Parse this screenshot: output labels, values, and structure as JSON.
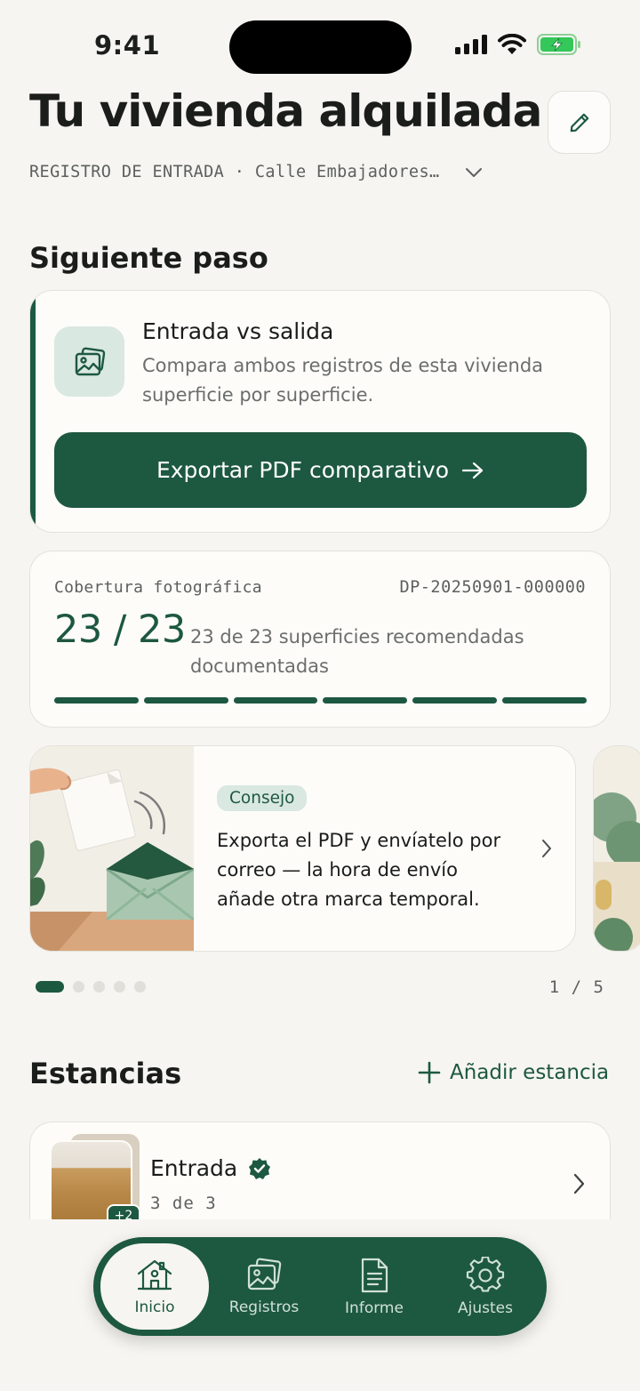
{
  "status_bar": {
    "time": "9:41"
  },
  "header": {
    "title": "Tu vivienda alquilada",
    "subline": "REGISTRO DE ENTRADA · Calle Embajadores…"
  },
  "next_step": {
    "section_title": "Siguiente paso",
    "card_title": "Entrada vs salida",
    "card_description": "Compara ambos registros de esta vivienda superficie por superficie.",
    "button_label": "Exportar PDF comparativo"
  },
  "coverage": {
    "label": "Cobertura fotográfica",
    "code": "DP-20250901-000000",
    "count": "23 / 23",
    "description": "23 de 23 superficies recomendadas documentadas",
    "segments_total": 6,
    "segments_filled": 6
  },
  "tip": {
    "badge": "Consejo",
    "text": "Exporta el PDF y envíatelo por correo — la hora de envío añade otra marca temporal.",
    "page_indicator": "1 / 5",
    "active_index": 0,
    "total": 5
  },
  "rooms": {
    "section_title": "Estancias",
    "add_label": "Añadir estancia",
    "items": [
      {
        "name": "Entrada",
        "progress": "3 de 3",
        "extra_photos": "+2",
        "verified": true
      }
    ]
  },
  "tabbar": {
    "items": [
      {
        "label": "Inicio",
        "icon": "home-icon",
        "active": true
      },
      {
        "label": "Registros",
        "icon": "photos-icon",
        "active": false
      },
      {
        "label": "Informe",
        "icon": "document-icon",
        "active": false
      },
      {
        "label": "Ajustes",
        "icon": "gear-icon",
        "active": false
      }
    ]
  },
  "colors": {
    "background": "#f6f5f1",
    "accent": "#1d5840",
    "accent_soft": "#d9e8e0",
    "card": "#fdfcf9",
    "battery": "#34c759"
  }
}
